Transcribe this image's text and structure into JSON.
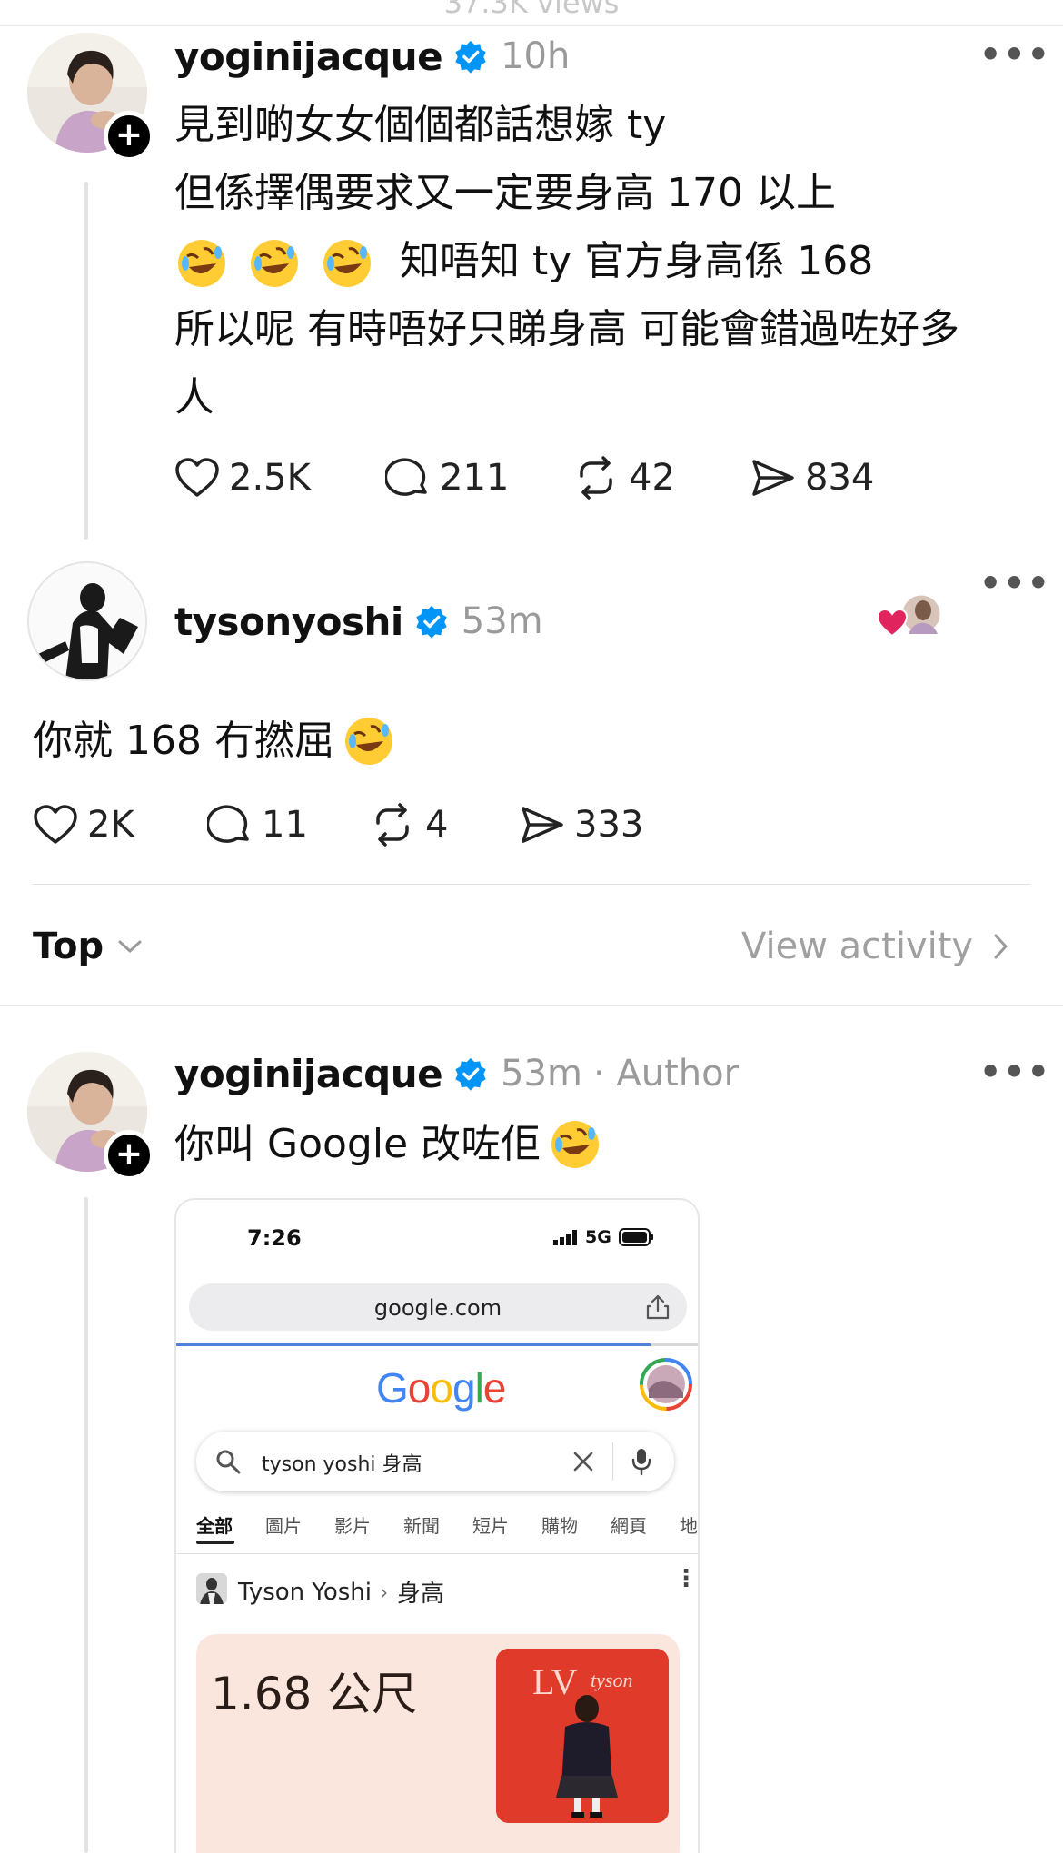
{
  "header": {
    "views_text": "37.3K views"
  },
  "posts": [
    {
      "username": "yoginijacque",
      "time": "10h",
      "lines": [
        "見到啲女女個個都話想嫁 ty",
        "但係擇偶要求又一定要身高 170 以上",
        "知唔知 ty 官方身高係 168",
        "所以呢 有時唔好只睇身高 可能會錯過咗好多",
        "人"
      ],
      "stats": {
        "likes": "2.5K",
        "replies": "211",
        "reposts": "42",
        "shares": "834"
      }
    },
    {
      "username": "tysonyoshi",
      "time": "53m",
      "text": "你就 168 冇撚屈",
      "stats": {
        "likes": "2K",
        "replies": "11",
        "reposts": "4",
        "shares": "333"
      }
    }
  ],
  "sort": {
    "label": "Top",
    "view_activity": "View activity"
  },
  "reply": {
    "username": "yoginijacque",
    "time": "53m",
    "author_tag": "· Author",
    "text": "你叫 Google 改咗佢"
  },
  "embedded": {
    "clock": "7:26",
    "network": "5G",
    "url": "google.com",
    "logo_letters": [
      "G",
      "o",
      "o",
      "g",
      "l",
      "e"
    ],
    "logo_colors": [
      "#4285F4",
      "#EA4335",
      "#FBBC05",
      "#4285F4",
      "#34A853",
      "#EA4335"
    ],
    "query": "tyson yoshi 身高",
    "tabs": [
      "全部",
      "圖片",
      "影片",
      "新聞",
      "短片",
      "購物",
      "網頁",
      "地"
    ],
    "result_title": "Tyson Yoshi",
    "result_sub": "身高",
    "height": "1.68 公尺",
    "photo_logo": "LV",
    "photo_text": "tyson"
  },
  "colors": {
    "verified": "#0095f6",
    "heart_red": "#e0245e"
  }
}
